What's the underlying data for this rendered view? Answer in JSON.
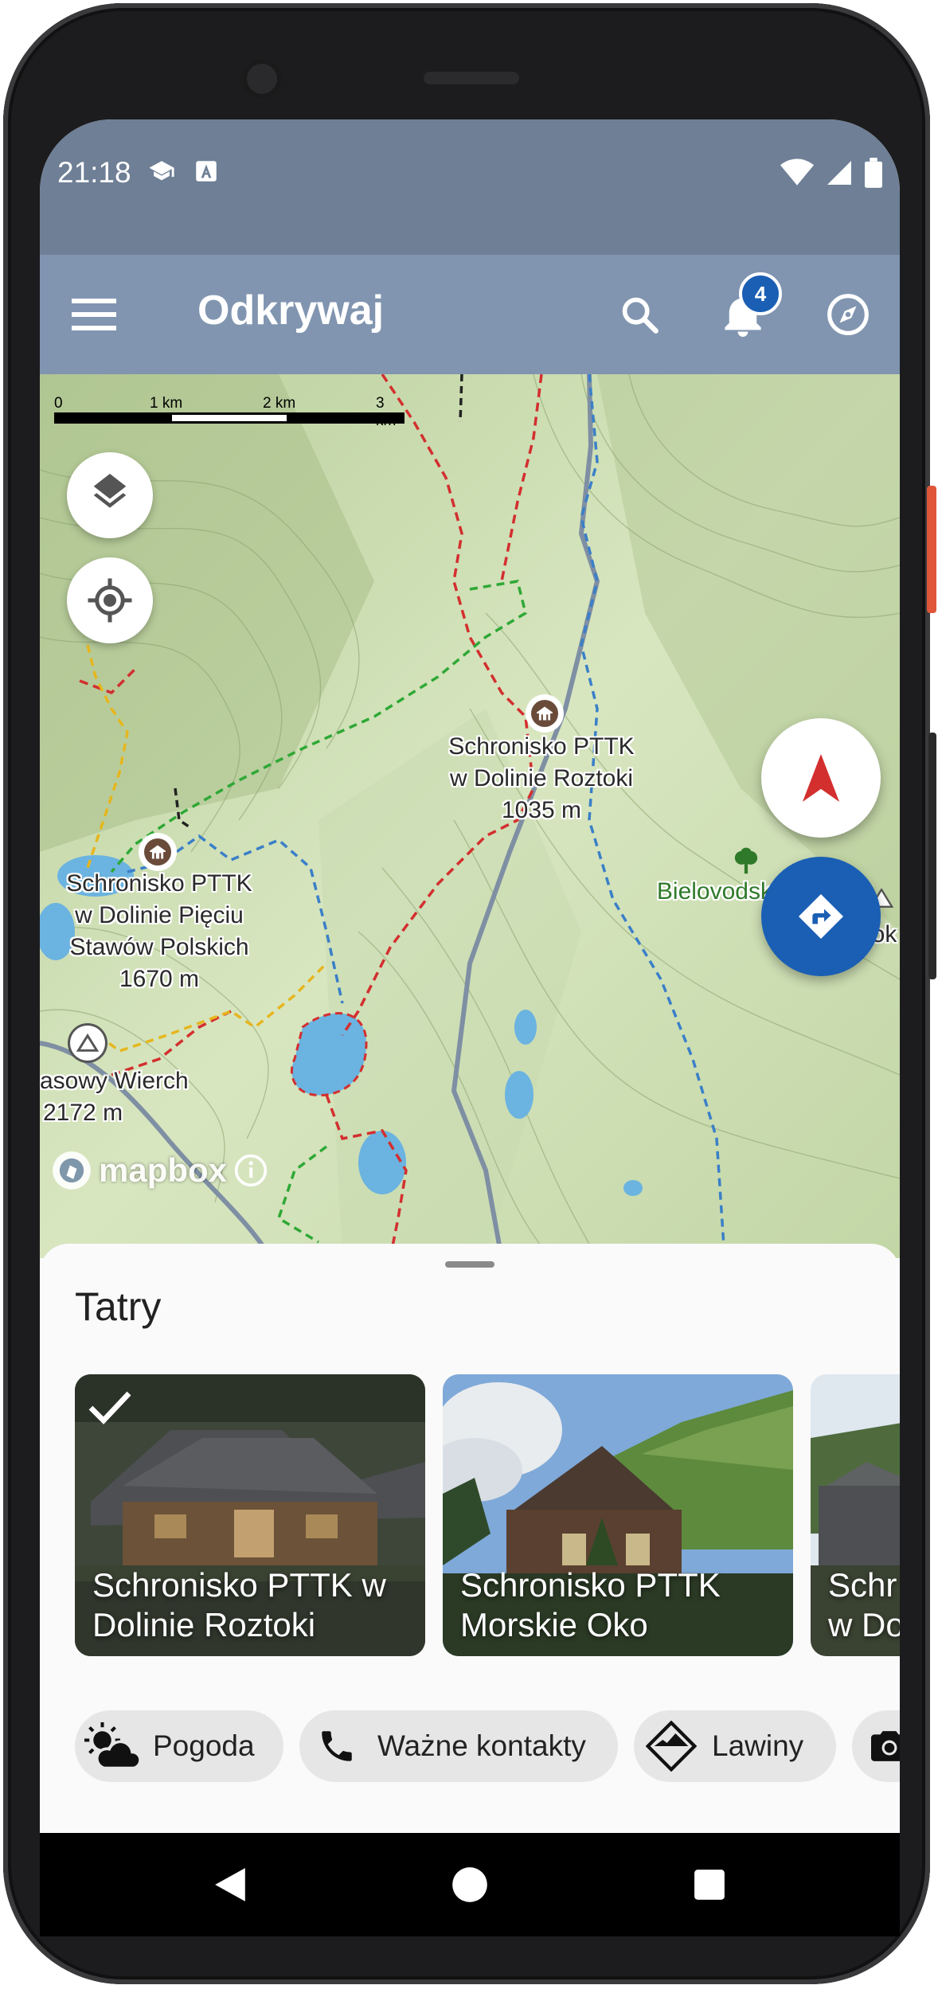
{
  "status_bar": {
    "time": "21:18",
    "icons_left": [
      "school-icon",
      "text-a-icon"
    ],
    "icons_right": [
      "wifi-icon",
      "cellular-signal-icon",
      "battery-icon"
    ]
  },
  "app_bar": {
    "title": "Odkrywaj",
    "menu_icon": "menu-icon",
    "search_icon": "search-icon",
    "notifications_icon": "bell-icon",
    "notification_count": "4",
    "compass_icon": "compass-icon",
    "background": "#8195b0"
  },
  "map": {
    "scale": {
      "labels": [
        "0",
        "1 km",
        "2 km",
        "3 km"
      ]
    },
    "layers_button_icon": "layers-icon",
    "locate_button_icon": "my-location-icon",
    "labels": {
      "roztoki": [
        "Schronisko PTTK",
        "w Dolinie Roztoki",
        "1035 m"
      ],
      "pieciu_stawow": [
        "Schronisko PTTK",
        "w Dolinie Pięciu",
        "Stawów Polskich",
        "1670 m"
      ],
      "bielovodska": "Bielovodská dolina",
      "wierch": [
        "asowy Wierch",
        "2172 m"
      ],
      "sirok": "Širok"
    },
    "attribution": "mapbox",
    "north_button_icon": "navigation-arrow-icon",
    "directions_button_icon": "directions-icon",
    "accent_red": "#d32f2f",
    "accent_blue": "#1a5fb4"
  },
  "sheet": {
    "title": "Tatry",
    "cards": [
      {
        "label": "Schronisko PTTK w Dolinie Roztoki",
        "checked": true
      },
      {
        "label": "Schronisko PTTK Morskie Oko",
        "checked": false
      },
      {
        "label": "Schronisko PTTK w Dolinie",
        "checked": false
      }
    ],
    "card_labels_visible": [
      "Schronisko PTTK w",
      "Dolinie Roztoki",
      "Schronisko PTTK",
      "Morskie Oko",
      "Schr",
      "w Do"
    ],
    "chips": [
      {
        "label": "Pogoda",
        "icon": "weather-partly-cloudy-icon"
      },
      {
        "label": "Ważne kontakty",
        "icon": "phone-icon"
      },
      {
        "label": "Lawiny",
        "icon": "avalanche-icon"
      },
      {
        "label": "",
        "icon": "camera-icon"
      }
    ]
  },
  "nav_bar": {
    "back_icon": "back-triangle-icon",
    "home_icon": "home-circle-icon",
    "recents_icon": "recents-square-icon"
  }
}
